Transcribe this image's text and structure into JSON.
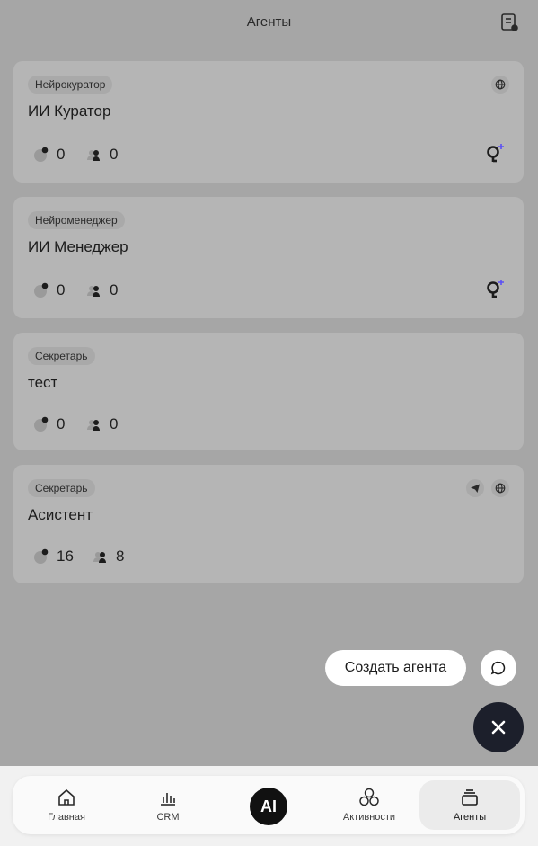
{
  "header": {
    "title": "Агенты",
    "icon": "notebook-pen-icon"
  },
  "agents": [
    {
      "tag": "Нейрокуратор",
      "name": "ИИ Куратор",
      "chats": "0",
      "users": "0",
      "channels": [
        "globe-icon"
      ],
      "has_logo": true
    },
    {
      "tag": "Нейроменеджер",
      "name": "ИИ Менеджер",
      "chats": "0",
      "users": "0",
      "channels": [],
      "has_logo": true
    },
    {
      "tag": "Секретарь",
      "name": "тест",
      "chats": "0",
      "users": "0",
      "channels": [],
      "has_logo": false
    },
    {
      "tag": "Секретарь",
      "name": "Асистент",
      "chats": "16",
      "users": "8",
      "channels": [
        "telegram-icon",
        "globe-icon"
      ],
      "has_logo": false
    }
  ],
  "fab": {
    "create_label": "Создать агента",
    "chat_icon": "chat-bubble-icon",
    "close_icon": "close-icon"
  },
  "nav": {
    "items": [
      {
        "label": "Главная",
        "icon": "home-icon"
      },
      {
        "label": "CRM",
        "icon": "bar-chart-icon"
      },
      {
        "label": "AI",
        "icon": "ai-icon"
      },
      {
        "label": "Активности",
        "icon": "circles-icon"
      },
      {
        "label": "Агенты",
        "icon": "layers-icon"
      }
    ],
    "active": "Агенты"
  },
  "colors": {
    "accent": "#5b4ff5",
    "fab_dark": "#1c1f2b",
    "overlay": "#a6a6a6"
  }
}
